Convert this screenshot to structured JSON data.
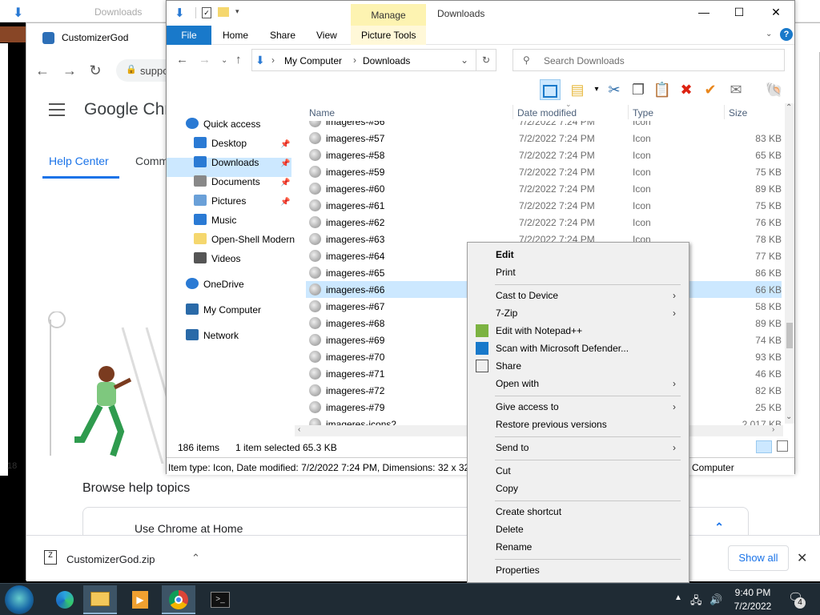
{
  "background_window": {
    "title": "Downloads",
    "side_number": "18"
  },
  "chrome": {
    "window_title": "CustomizerGod",
    "address_text": "suppo",
    "page_title": "Google Chr",
    "tabs": [
      "Help Center",
      "Comm"
    ],
    "browse_heading": "Browse help topics",
    "card_label": "Use Chrome at Home",
    "download_bar": {
      "file_name": "CustomizerGod.zip",
      "show_all_label": "Show all"
    }
  },
  "explorer": {
    "ribbon_context_tab": "Manage",
    "window_title": "Downloads",
    "ribbon_tabs": [
      "File",
      "Home",
      "Share",
      "View",
      "Picture Tools"
    ],
    "breadcrumb": [
      "My Computer",
      "Downloads"
    ],
    "search_placeholder": "Search Downloads",
    "nav_items": [
      {
        "label": "Quick access",
        "icon": "star-icon"
      },
      {
        "label": "Desktop",
        "icon": "desktop-icon"
      },
      {
        "label": "Downloads",
        "icon": "download-arrow-icon"
      },
      {
        "label": "Documents",
        "icon": "documents-icon"
      },
      {
        "label": "Pictures",
        "icon": "pictures-icon"
      },
      {
        "label": "Music",
        "icon": "music-note-icon"
      },
      {
        "label": "Open-Shell Modern",
        "icon": "folder-icon"
      },
      {
        "label": "Videos",
        "icon": "videos-icon"
      },
      {
        "label": "OneDrive",
        "icon": "cloud-icon"
      },
      {
        "label": "My Computer",
        "icon": "computer-icon"
      },
      {
        "label": "Network",
        "icon": "network-icon"
      }
    ],
    "columns": [
      "Name",
      "Date modified",
      "Type",
      "Size"
    ],
    "files": [
      {
        "name": "imageres-#56",
        "date": "7/2/2022 7:24 PM",
        "type": "Icon",
        "size": ""
      },
      {
        "name": "imageres-#57",
        "date": "7/2/2022 7:24 PM",
        "type": "Icon",
        "size": "83 KB"
      },
      {
        "name": "imageres-#58",
        "date": "7/2/2022 7:24 PM",
        "type": "Icon",
        "size": "65 KB"
      },
      {
        "name": "imageres-#59",
        "date": "7/2/2022 7:24 PM",
        "type": "Icon",
        "size": "75 KB"
      },
      {
        "name": "imageres-#60",
        "date": "7/2/2022 7:24 PM",
        "type": "Icon",
        "size": "89 KB"
      },
      {
        "name": "imageres-#61",
        "date": "7/2/2022 7:24 PM",
        "type": "Icon",
        "size": "75 KB"
      },
      {
        "name": "imageres-#62",
        "date": "7/2/2022 7:24 PM",
        "type": "Icon",
        "size": "76 KB"
      },
      {
        "name": "imageres-#63",
        "date": "7/2/2022 7:24 PM",
        "type": "Icon",
        "size": "78 KB"
      },
      {
        "name": "imageres-#64",
        "date": "",
        "type": "",
        "size": "77 KB"
      },
      {
        "name": "imageres-#65",
        "date": "",
        "type": "",
        "size": "86 KB"
      },
      {
        "name": "imageres-#66",
        "date": "",
        "type": "",
        "size": "66 KB"
      },
      {
        "name": "imageres-#67",
        "date": "",
        "type": "",
        "size": "58 KB"
      },
      {
        "name": "imageres-#68",
        "date": "",
        "type": "",
        "size": "89 KB"
      },
      {
        "name": "imageres-#69",
        "date": "",
        "type": "",
        "size": "74 KB"
      },
      {
        "name": "imageres-#70",
        "date": "",
        "type": "",
        "size": "93 KB"
      },
      {
        "name": "imageres-#71",
        "date": "",
        "type": "",
        "size": "46 KB"
      },
      {
        "name": "imageres-#72",
        "date": "",
        "type": "",
        "size": "82 KB"
      },
      {
        "name": "imageres-#79",
        "date": "",
        "type": "",
        "size": "25 KB"
      },
      {
        "name": "imageres-icons2",
        "date": "",
        "type": "",
        "size": "2,017 KB"
      }
    ],
    "selected_file": "imageres-#66",
    "status": {
      "count": "186 items",
      "selection": "1 item selected",
      "size": "65.3 KB"
    },
    "details_bar": "Item type: Icon, Date modified: 7/2/2022 7:24 PM, Dimensions: 32 x 32,",
    "details_bar_right": "Computer"
  },
  "context_menu": [
    {
      "label": "Edit",
      "bold": true
    },
    {
      "label": "Print"
    },
    {
      "label": "Cast to Device",
      "submenu": true
    },
    {
      "label": "7-Zip",
      "submenu": true
    },
    {
      "label": "Edit with Notepad++",
      "icon": "notepad-icon"
    },
    {
      "label": "Scan with Microsoft Defender...",
      "icon": "defender-shield-icon"
    },
    {
      "label": "Share",
      "icon": "share-icon"
    },
    {
      "label": "Open with",
      "submenu": true
    },
    {
      "label": "Give access to",
      "submenu": true
    },
    {
      "label": "Restore previous versions"
    },
    {
      "label": "Send to",
      "submenu": true
    },
    {
      "label": "Cut"
    },
    {
      "label": "Copy"
    },
    {
      "label": "Create shortcut"
    },
    {
      "label": "Delete"
    },
    {
      "label": "Rename"
    },
    {
      "label": "Properties"
    }
  ],
  "taskbar": {
    "time": "9:40 PM",
    "date": "7/2/2022",
    "notifications": "4"
  },
  "colors": {
    "accent": "#1979ca",
    "selection": "#cce8ff",
    "manage_tab": "#fdf3b1",
    "taskbar": "#1f2b34"
  }
}
